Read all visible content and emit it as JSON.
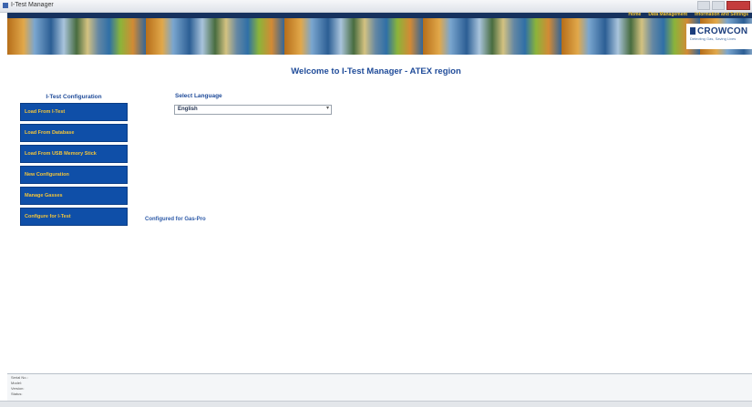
{
  "window": {
    "title": "I-Test Manager",
    "icons": {
      "app": "app-icon",
      "minimize": "minimize-icon",
      "maximize": "maximize-icon",
      "close": "close-icon"
    }
  },
  "nav": {
    "items": [
      "Home",
      "Data Management",
      "Information and Settings"
    ]
  },
  "brand": {
    "logo_text": "CROWCON",
    "tagline": "Detecting Gas, Saving Lives"
  },
  "page": {
    "title": "Welcome to I-Test Manager - ATEX region"
  },
  "configuration": {
    "title": "I-Test Configuration",
    "buttons": [
      "Load From I-Test",
      "Load From Database",
      "Load From USB Memory Stick",
      "New Configuration",
      "Manage Gasses",
      "Configure for I-Test"
    ],
    "status": "Configured for Gas-Pro"
  },
  "language": {
    "label": "Select Language",
    "selected": "English"
  },
  "status_panel": {
    "lines": [
      "Serial No.:",
      "Model:",
      "Version:",
      "Status:"
    ]
  },
  "colors": {
    "button_bg": "#0f4fa8",
    "button_text": "#f2c43a",
    "heading": "#1f4b99",
    "nav_text": "#f3c431"
  }
}
